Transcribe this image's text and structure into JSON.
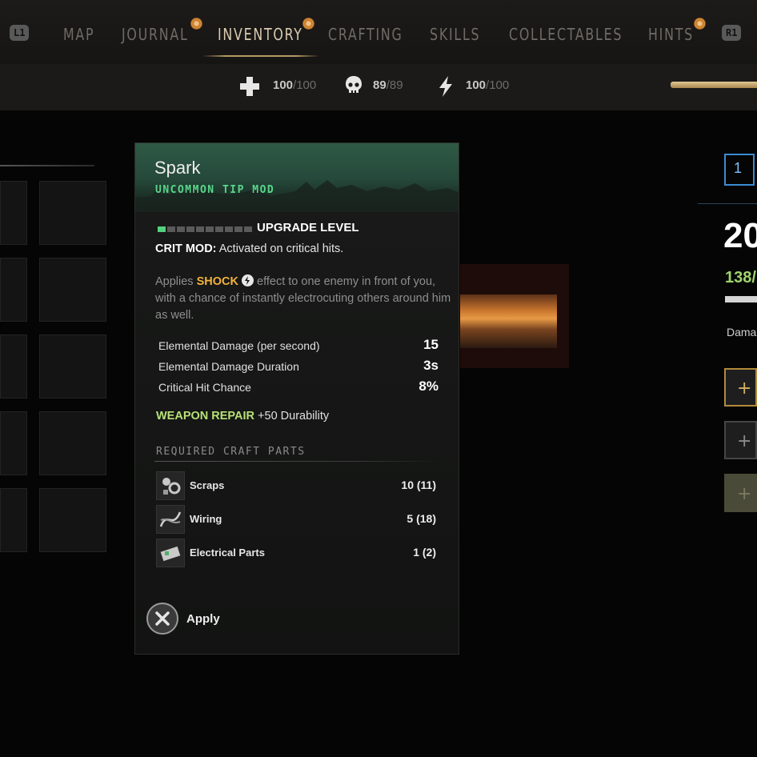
{
  "nav": {
    "left_button": "L1",
    "right_button": "R1",
    "tabs": [
      {
        "label": "MAP",
        "active": false,
        "notify": false
      },
      {
        "label": "JOURNAL",
        "active": false,
        "notify": true
      },
      {
        "label": "INVENTORY",
        "active": true,
        "notify": true
      },
      {
        "label": "CRAFTING",
        "active": false,
        "notify": false
      },
      {
        "label": "SKILLS",
        "active": false,
        "notify": false
      },
      {
        "label": "COLLECTABLES",
        "active": false,
        "notify": false
      },
      {
        "label": "HINTS",
        "active": false,
        "notify": true
      }
    ]
  },
  "stats": [
    {
      "icon": "health-cross-icon",
      "value": "100",
      "max": "/100"
    },
    {
      "icon": "skull-icon",
      "value": "89",
      "max": "/89"
    },
    {
      "icon": "lightning-icon",
      "value": "100",
      "max": "/100"
    }
  ],
  "tooltip": {
    "title": "Spark",
    "subtitle": "UNCOMMON TIP MOD",
    "upgrade": {
      "label": "UPGRADE LEVEL",
      "level": 1,
      "max_level": 10
    },
    "crit_label": "CRIT MOD:",
    "crit_text": "Activated on critical hits.",
    "desc_pre": "Applies",
    "desc_keyword": "SHOCK",
    "desc_post": "effect to one enemy in front of you, with a chance of instantly electrocuting others around him as well.",
    "stats": [
      {
        "label": "Elemental Damage (per second)",
        "value": "15"
      },
      {
        "label": "Elemental Damage Duration",
        "value": "3s"
      },
      {
        "label": "Critical Hit Chance",
        "value": "8%"
      }
    ],
    "repair_label": "WEAPON REPAIR",
    "repair_value": "+50 Durability",
    "required_header": "REQUIRED CRAFT PARTS",
    "parts": [
      {
        "name": "Scraps",
        "qty": "10 (11)",
        "icon": "scraps-icon"
      },
      {
        "name": "Wiring",
        "qty": "5 (18)",
        "icon": "wiring-icon"
      },
      {
        "name": "Electrical Parts",
        "qty": "1 (2)",
        "icon": "electrical-parts-icon"
      }
    ],
    "apply_label": "Apply"
  },
  "right_panel": {
    "slot_number": "1",
    "big_value": "20",
    "green_value": "138/",
    "damage_label": "Dama"
  },
  "colors": {
    "accent_green": "#53d17d",
    "keyword_orange": "#f3b23d",
    "repair_green": "#b8e077",
    "selection_blue": "#3b8cd3"
  }
}
